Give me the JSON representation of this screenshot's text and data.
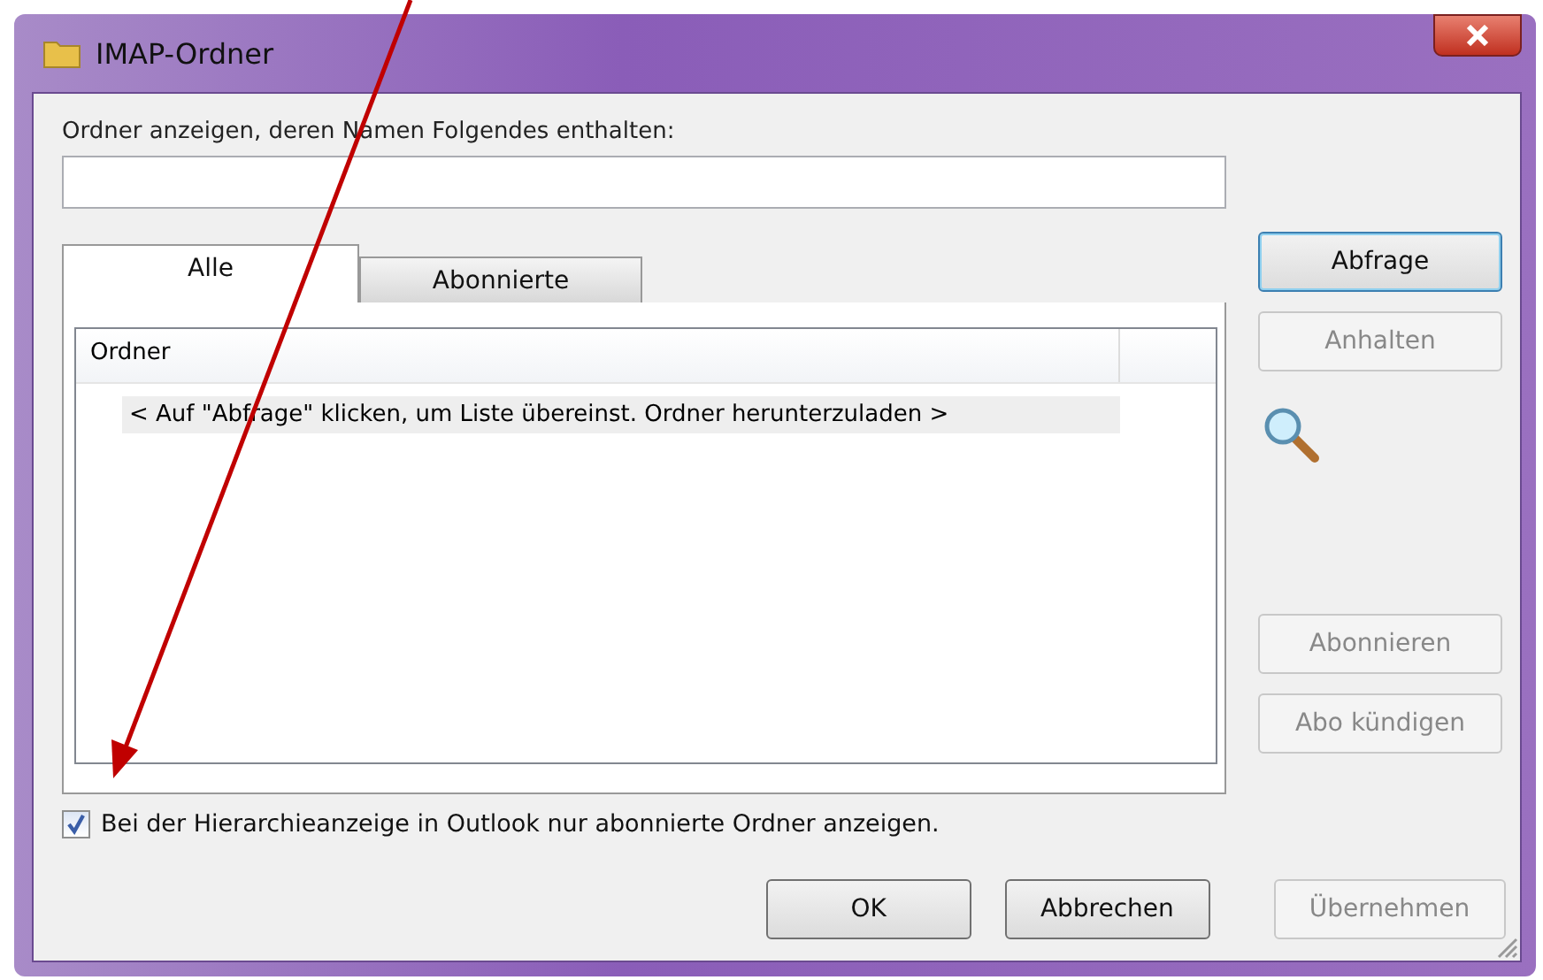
{
  "window": {
    "title": "IMAP-Ordner"
  },
  "filter": {
    "label": "Ordner anzeigen, deren Namen Folgendes enthalten:"
  },
  "tabs": [
    {
      "label": "Alle",
      "selected": true
    },
    {
      "label": "Abonnierte",
      "selected": false
    }
  ],
  "table": {
    "columns": [
      "Ordner"
    ],
    "rows": [
      "< Auf \"Abfrage\" klicken, um Liste übereinst. Ordner herunterzuladen >"
    ]
  },
  "side_buttons": [
    {
      "label": "Abfrage",
      "disabled": false,
      "default": true
    },
    {
      "label": "Anhalten",
      "disabled": true,
      "default": false
    }
  ],
  "subscribe_buttons": [
    {
      "label": "Abonnieren",
      "disabled": true
    },
    {
      "label": "Abo kündigen",
      "disabled": true
    }
  ],
  "option": {
    "label": "Bei der Hierarchieanzeige in Outlook nur abonnierte Ordner anzeigen.",
    "checked": true
  },
  "buttons": [
    {
      "label": "OK",
      "disabled": false
    },
    {
      "label": "Abbrechen",
      "disabled": false
    },
    {
      "label": "Übernehmen",
      "disabled": true
    }
  ]
}
